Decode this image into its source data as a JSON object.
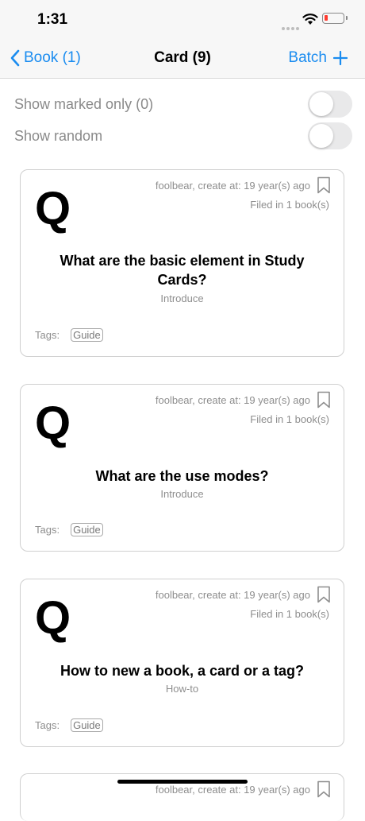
{
  "status_bar": {
    "time": "1:31",
    "battery_color": "#ff3b30"
  },
  "nav": {
    "back_label": "Book (1)",
    "title": "Card (9)",
    "batch_label": "Batch",
    "accent_color": "#1a8cf0"
  },
  "filters": {
    "marked_only_label": "Show marked only (0)",
    "marked_only_on": false,
    "random_label": "Show random",
    "random_on": false
  },
  "cards": [
    {
      "q_mark": "Q",
      "meta": "foolbear, create at: 19 year(s) ago",
      "filed": "Filed in 1 book(s)",
      "question": "What are the basic element in Study Cards?",
      "category": "Introduce",
      "tags_label": "Tags:",
      "tag": "Guide"
    },
    {
      "q_mark": "Q",
      "meta": "foolbear, create at: 19 year(s) ago",
      "filed": "Filed in 1 book(s)",
      "question": "What are the use modes?",
      "category": "Introduce",
      "tags_label": "Tags:",
      "tag": "Guide"
    },
    {
      "q_mark": "Q",
      "meta": "foolbear, create at: 19 year(s) ago",
      "filed": "Filed in 1 book(s)",
      "question": "How to new a book, a card or a tag?",
      "category": "How-to",
      "tags_label": "Tags:",
      "tag": "Guide"
    },
    {
      "meta": "foolbear, create at: 19 year(s) ago"
    }
  ]
}
